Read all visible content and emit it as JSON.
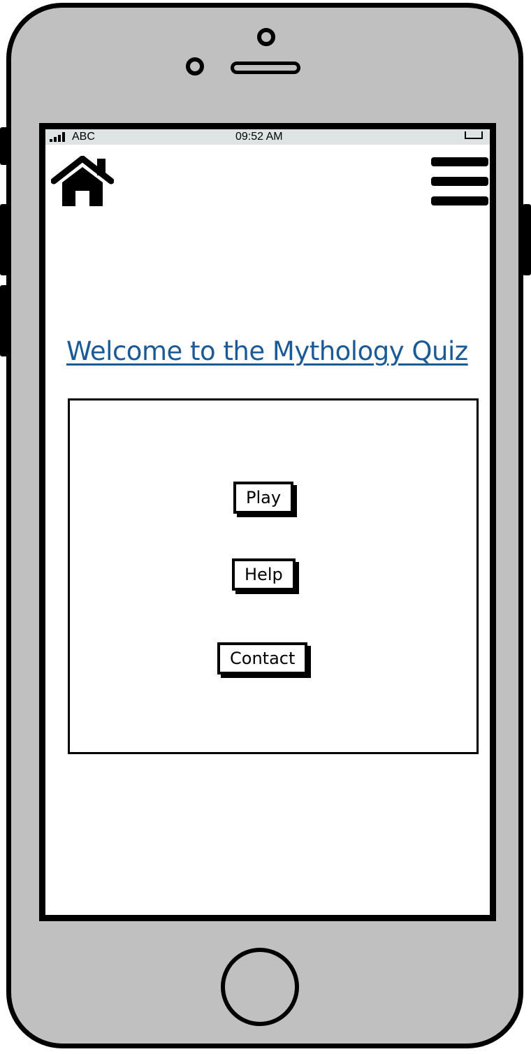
{
  "status_bar": {
    "carrier": "ABC",
    "time": "09:52 AM"
  },
  "header": {
    "home_icon": "home-icon",
    "menu_icon": "hamburger-menu-icon"
  },
  "main": {
    "title": "Welcome to the Mythology Quiz",
    "buttons": {
      "play": "Play",
      "help": "Help",
      "contact": "Contact"
    }
  },
  "colors": {
    "title": "#1a5a96",
    "device_body": "#c0c0c0",
    "status_bar": "#dde4e3"
  }
}
